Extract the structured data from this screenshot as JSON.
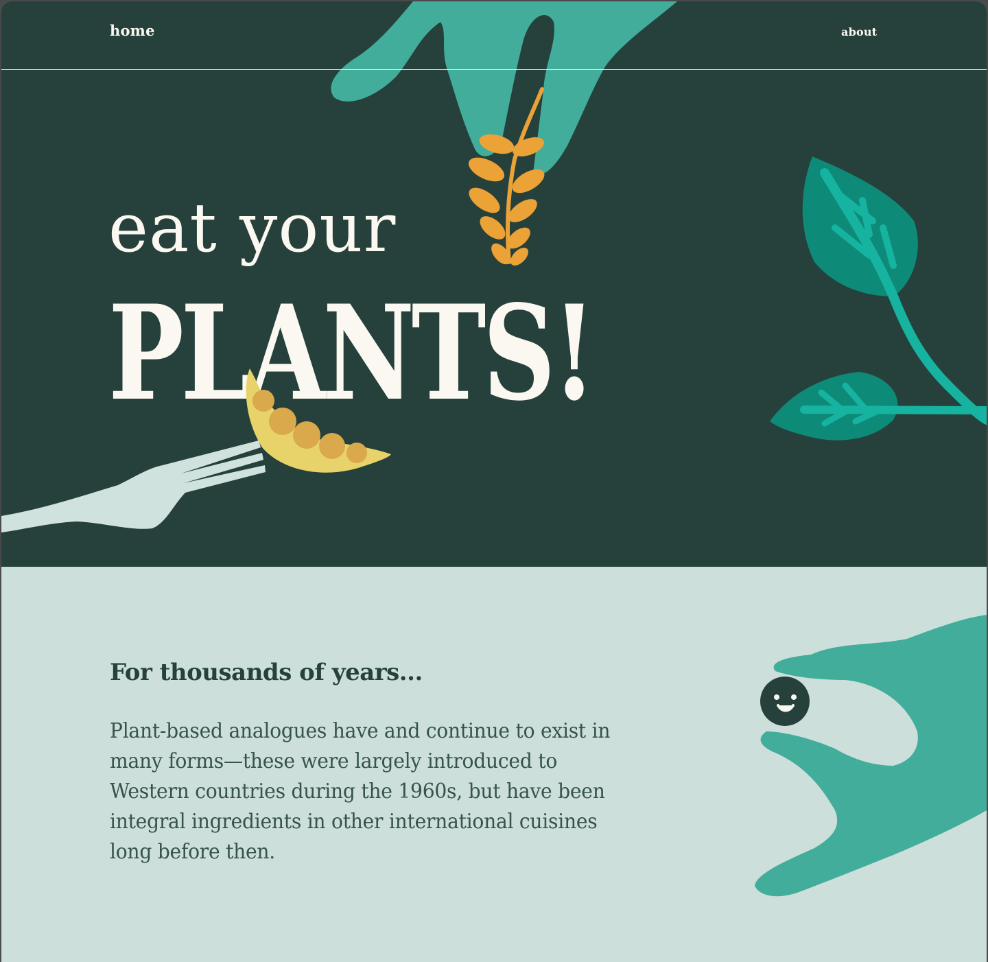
{
  "nav": {
    "home_label": "home",
    "about_label": "about"
  },
  "hero": {
    "line1": "eat your",
    "line2": "PLANTS!"
  },
  "story": {
    "heading": "For thousands of years...",
    "body": "Plant-based analogues have and continue to exist in many forms—these were largely introduced to Western countries during the 1960s, but have been integral ingredients in other international cuisines long before then."
  },
  "colors": {
    "hero_background": "#26413b",
    "section_background": "#cddfdb",
    "text_light": "#fbf7f1",
    "text_dark": "#26413b",
    "hand_teal": "#42ad9b",
    "leaf_teal": "#0e8a78",
    "wheat_orange": "#eba237",
    "pea_yellow": "#e8d36a",
    "fork_mint": "#cfe2de"
  },
  "illustrations": {
    "hero": [
      "hand-icon",
      "wheat-icon",
      "leaf-icon",
      "fork-icon",
      "pea-pod-icon"
    ],
    "story": [
      "hand-icon",
      "smiling-pea-icon"
    ]
  }
}
